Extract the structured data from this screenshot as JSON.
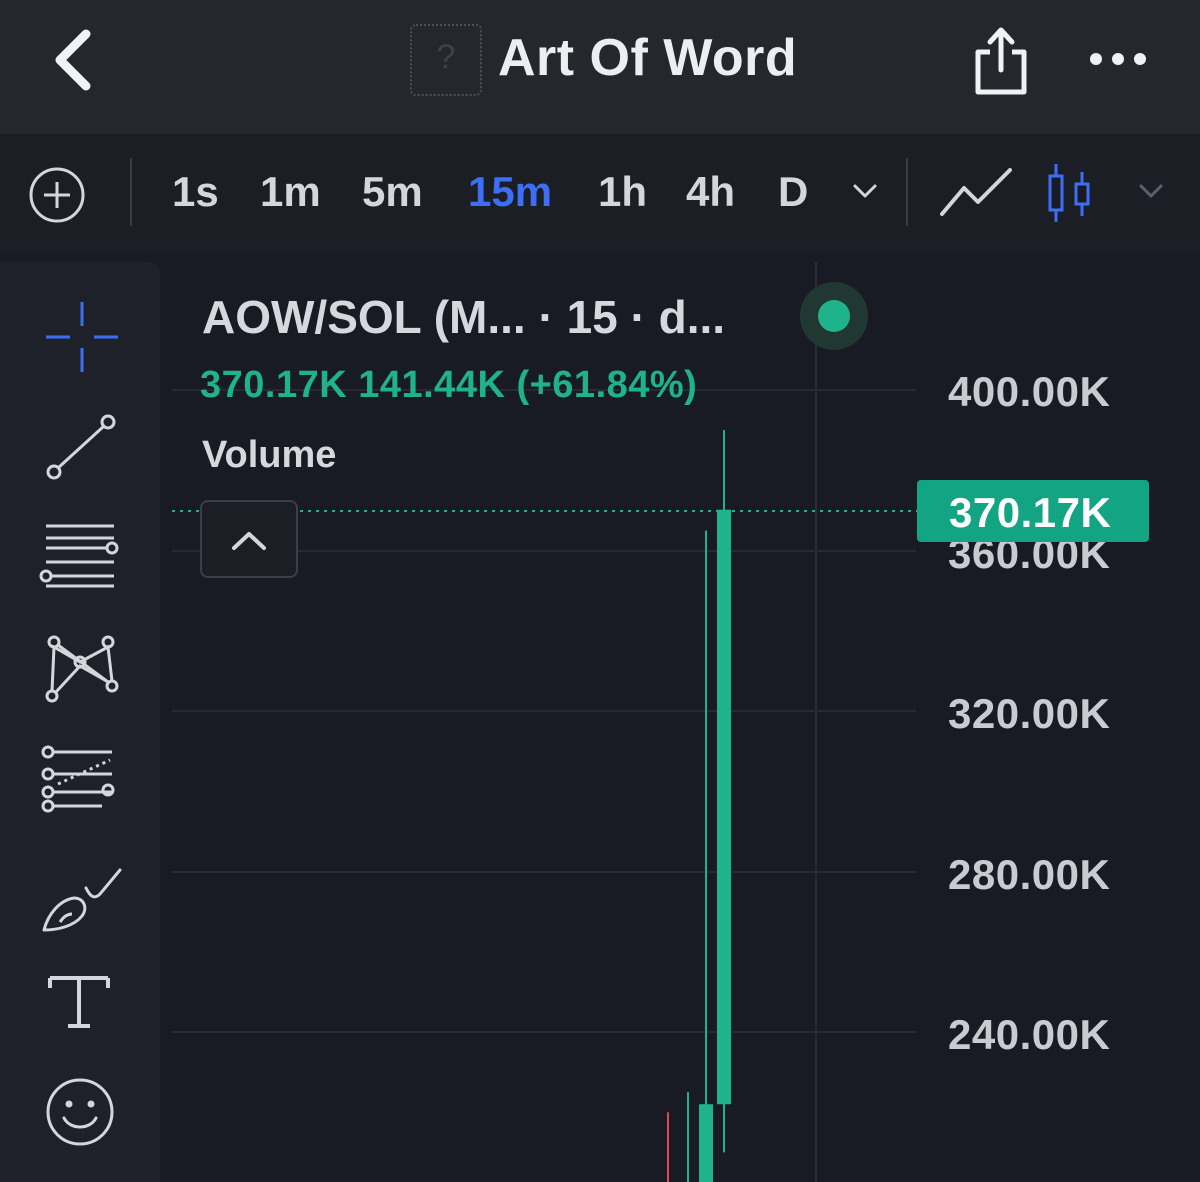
{
  "header": {
    "title": "Art Of Word",
    "token_icon_glyph": "?"
  },
  "toolbar": {
    "timeframes": [
      "1s",
      "1m",
      "5m",
      "15m",
      "1h",
      "4h",
      "D"
    ],
    "active_timeframe": "15m"
  },
  "chart": {
    "title": "AOW/SOL (M... · 15 · d...",
    "price_line": "370.17K  141.44K (+61.84%)",
    "indicator_label": "Volume",
    "current_price_label": "370.17K"
  },
  "colors": {
    "up": "#1fb38c",
    "down": "#e0484f",
    "accent": "#3d6ef6"
  },
  "chart_data": {
    "type": "candlestick",
    "y_axis_ticks": [
      "400.00K",
      "360.00K",
      "320.00K",
      "280.00K",
      "240.00K"
    ],
    "ylim": [
      200000,
      405000
    ],
    "current_price": 370170,
    "candles": [
      {
        "open": 195000,
        "close": 195000,
        "high": 220000,
        "low": 180000,
        "dir": "down"
      },
      {
        "open": 180000,
        "close": 195000,
        "high": 225000,
        "low": 180000,
        "dir": "up"
      },
      {
        "open": 180000,
        "close": 222000,
        "high": 365000,
        "low": 180000,
        "dir": "up"
      },
      {
        "open": 222000,
        "close": 370170,
        "high": 390000,
        "low": 210000,
        "dir": "up"
      }
    ]
  }
}
